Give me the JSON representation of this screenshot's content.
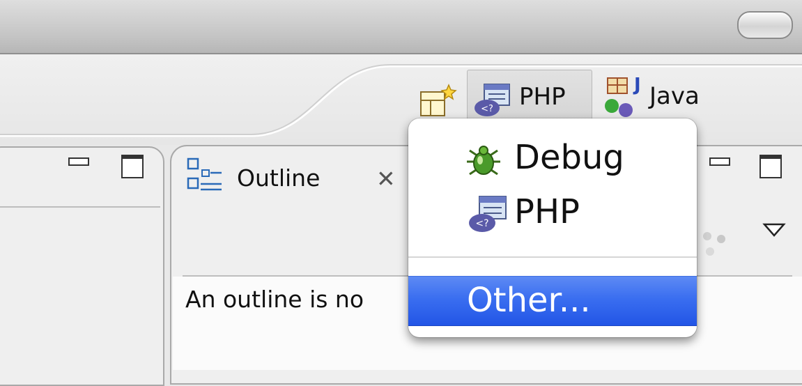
{
  "toolbar": {
    "perspectives": [
      {
        "label": "PHP",
        "icon": "php-perspective-icon",
        "active": true
      },
      {
        "label": "Java",
        "icon": "java-perspective-icon",
        "active": false
      }
    ]
  },
  "outline_view": {
    "tab_label": "Outline",
    "message": "An outline is no"
  },
  "perspective_menu": {
    "items": [
      {
        "label": "Debug",
        "icon": "debug-bug-icon"
      },
      {
        "label": "PHP",
        "icon": "php-perspective-icon"
      }
    ],
    "other_label": "Other..."
  },
  "colors": {
    "selection": "#3a6ef0",
    "php_icon": "#5a5aa8",
    "debug_icon": "#4a9a2a"
  }
}
